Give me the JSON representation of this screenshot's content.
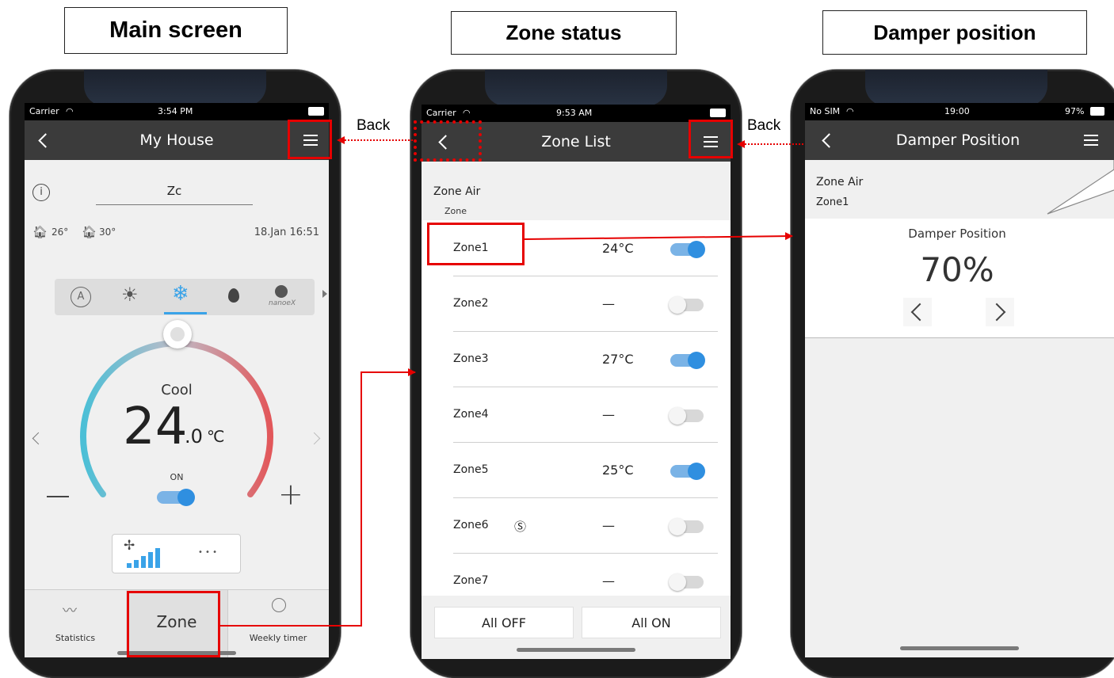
{
  "titles": {
    "main": "Main screen",
    "zone": "Zone status",
    "damper": "Damper position"
  },
  "annotations": {
    "back_left": "Back",
    "back_right": "Back"
  },
  "colors": {
    "highlight": "#e60000",
    "accent": "#2f8fe0",
    "navbar": "#3b3b3b"
  },
  "main_screen": {
    "status": {
      "carrier": "Carrier",
      "time": "3:54 PM"
    },
    "nav": {
      "title": "My House",
      "back_icon": "chevron-left-icon",
      "menu_icon": "hamburger-menu-icon"
    },
    "device_name": "Zc",
    "indoor_temp": "26°",
    "outdoor_temp": "30°",
    "datetime": "18.Jan 16:51",
    "modes": [
      "auto-mode-icon",
      "heat-mode-icon",
      "cool-mode-icon",
      "dry-mode-icon",
      "nanoex-icon"
    ],
    "nanoex_label": "nanoeX",
    "selected_mode": "cool",
    "mode_label": "Cool",
    "temperature": "24",
    "temperature_decimal": ".0",
    "temperature_unit": "℃",
    "power_label": "ON",
    "minus": "—",
    "plus": "+",
    "more": "• • •",
    "tabs": {
      "statistics": "Statistics",
      "zone": "Zone",
      "weekly": "Weekly timer"
    }
  },
  "zone_screen": {
    "status": {
      "carrier": "Carrier",
      "time": "9:53 AM"
    },
    "nav": {
      "title": "Zone List"
    },
    "section_title": "Zone Air",
    "section_subtitle": "Zone",
    "zones": [
      {
        "name": "Zone1",
        "temp": "24°C",
        "on": true,
        "symbol": ""
      },
      {
        "name": "Zone2",
        "temp": "—",
        "on": false,
        "symbol": ""
      },
      {
        "name": "Zone3",
        "temp": "27°C",
        "on": true,
        "symbol": ""
      },
      {
        "name": "Zone4",
        "temp": "—",
        "on": false,
        "symbol": ""
      },
      {
        "name": "Zone5",
        "temp": "25°C",
        "on": true,
        "symbol": ""
      },
      {
        "name": "Zone6",
        "temp": "—",
        "on": false,
        "symbol": "Ⓢ"
      },
      {
        "name": "Zone7",
        "temp": "—",
        "on": false,
        "symbol": ""
      }
    ],
    "buttons": {
      "all_off": "All OFF",
      "all_on": "All ON"
    }
  },
  "damper_screen": {
    "status": {
      "carrier": "No SIM",
      "time": "19:00",
      "battery": "97%"
    },
    "nav": {
      "title": "Damper Position"
    },
    "section_title": "Zone Air",
    "zone_name": "Zone1",
    "label": "Damper Position",
    "value": "70%"
  }
}
